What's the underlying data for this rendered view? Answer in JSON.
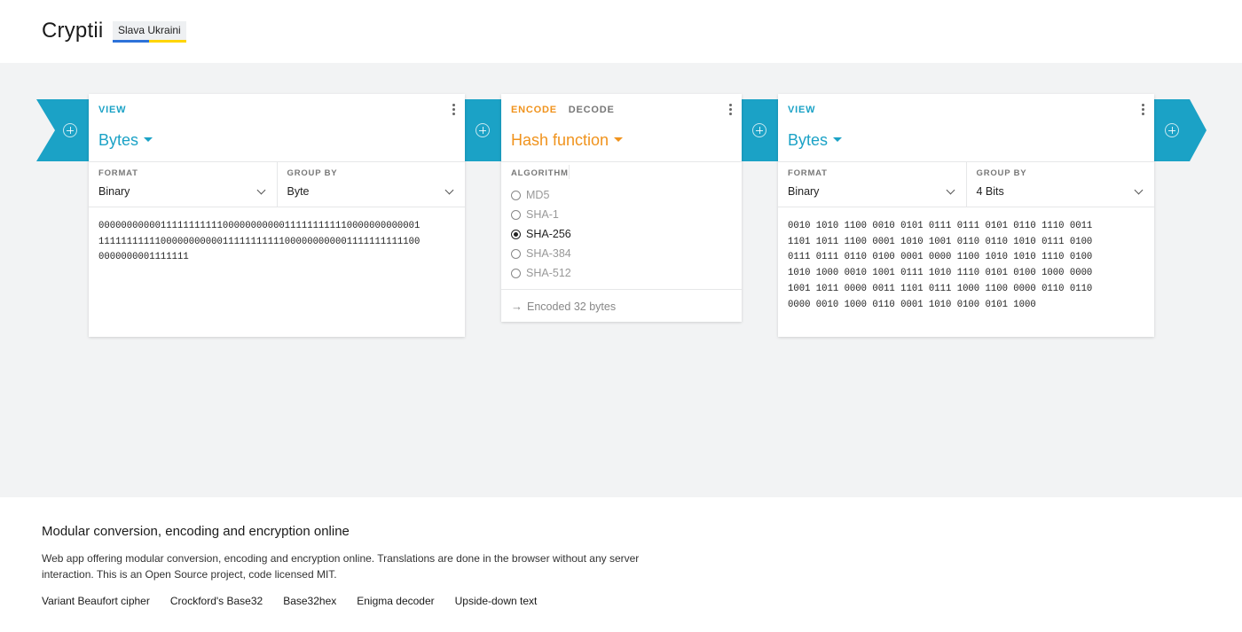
{
  "app": {
    "title": "Cryptii",
    "badge": "Slava Ukraini",
    "badge_colors": [
      "#2d72d9",
      "#ffd500"
    ]
  },
  "colors": {
    "view_accent": "#1ba2c6",
    "encoder_accent": "#f0931d",
    "workspace_bg": "#f2f3f4"
  },
  "bricks": [
    {
      "mode": "VIEW",
      "title": "Bytes",
      "settings": [
        {
          "label": "FORMAT",
          "value": "Binary"
        },
        {
          "label": "GROUP BY",
          "value": "Byte"
        }
      ],
      "content": "000000000001111111111100000000000111111111110000000000001\n111111111110000000000011111111111000000000001111111111100\n0000000001111111"
    },
    {
      "mode_encode": "ENCODE",
      "mode_decode": "DECODE",
      "title": "Hash function",
      "algorithm_label": "ALGORITHM",
      "algorithms": [
        "MD5",
        "SHA-1",
        "SHA-256",
        "SHA-384",
        "SHA-512"
      ],
      "selected_algorithm": "SHA-256",
      "status": "Encoded 32 bytes"
    },
    {
      "mode": "VIEW",
      "title": "Bytes",
      "settings": [
        {
          "label": "FORMAT",
          "value": "Binary"
        },
        {
          "label": "GROUP BY",
          "value": "4 Bits"
        }
      ],
      "content": "0010 1010 1100 0010 0101 0111 0111 0101 0110 1110 0011\n1101 1011 1100 0001 1010 1001 0110 0110 1010 0111 0100\n0111 0111 0110 0100 0001 0000 1100 1010 1010 1110 0100\n1010 1000 0010 1001 0111 1010 1110 0101 0100 1000 0000\n1001 1011 0000 0011 1101 0111 1000 1100 0000 0110 0110\n0000 0010 1000 0110 0001 1010 0100 0101 1000"
    }
  ],
  "footer": {
    "heading": "Modular conversion, encoding and encryption online",
    "description": "Web app offering modular conversion, encoding and encryption online. Translations are done in the browser without any server interaction. This is an Open Source project, code licensed MIT.",
    "links": [
      "Variant Beaufort cipher",
      "Crockford's Base32",
      "Base32hex",
      "Enigma decoder",
      "Upside-down text"
    ]
  }
}
